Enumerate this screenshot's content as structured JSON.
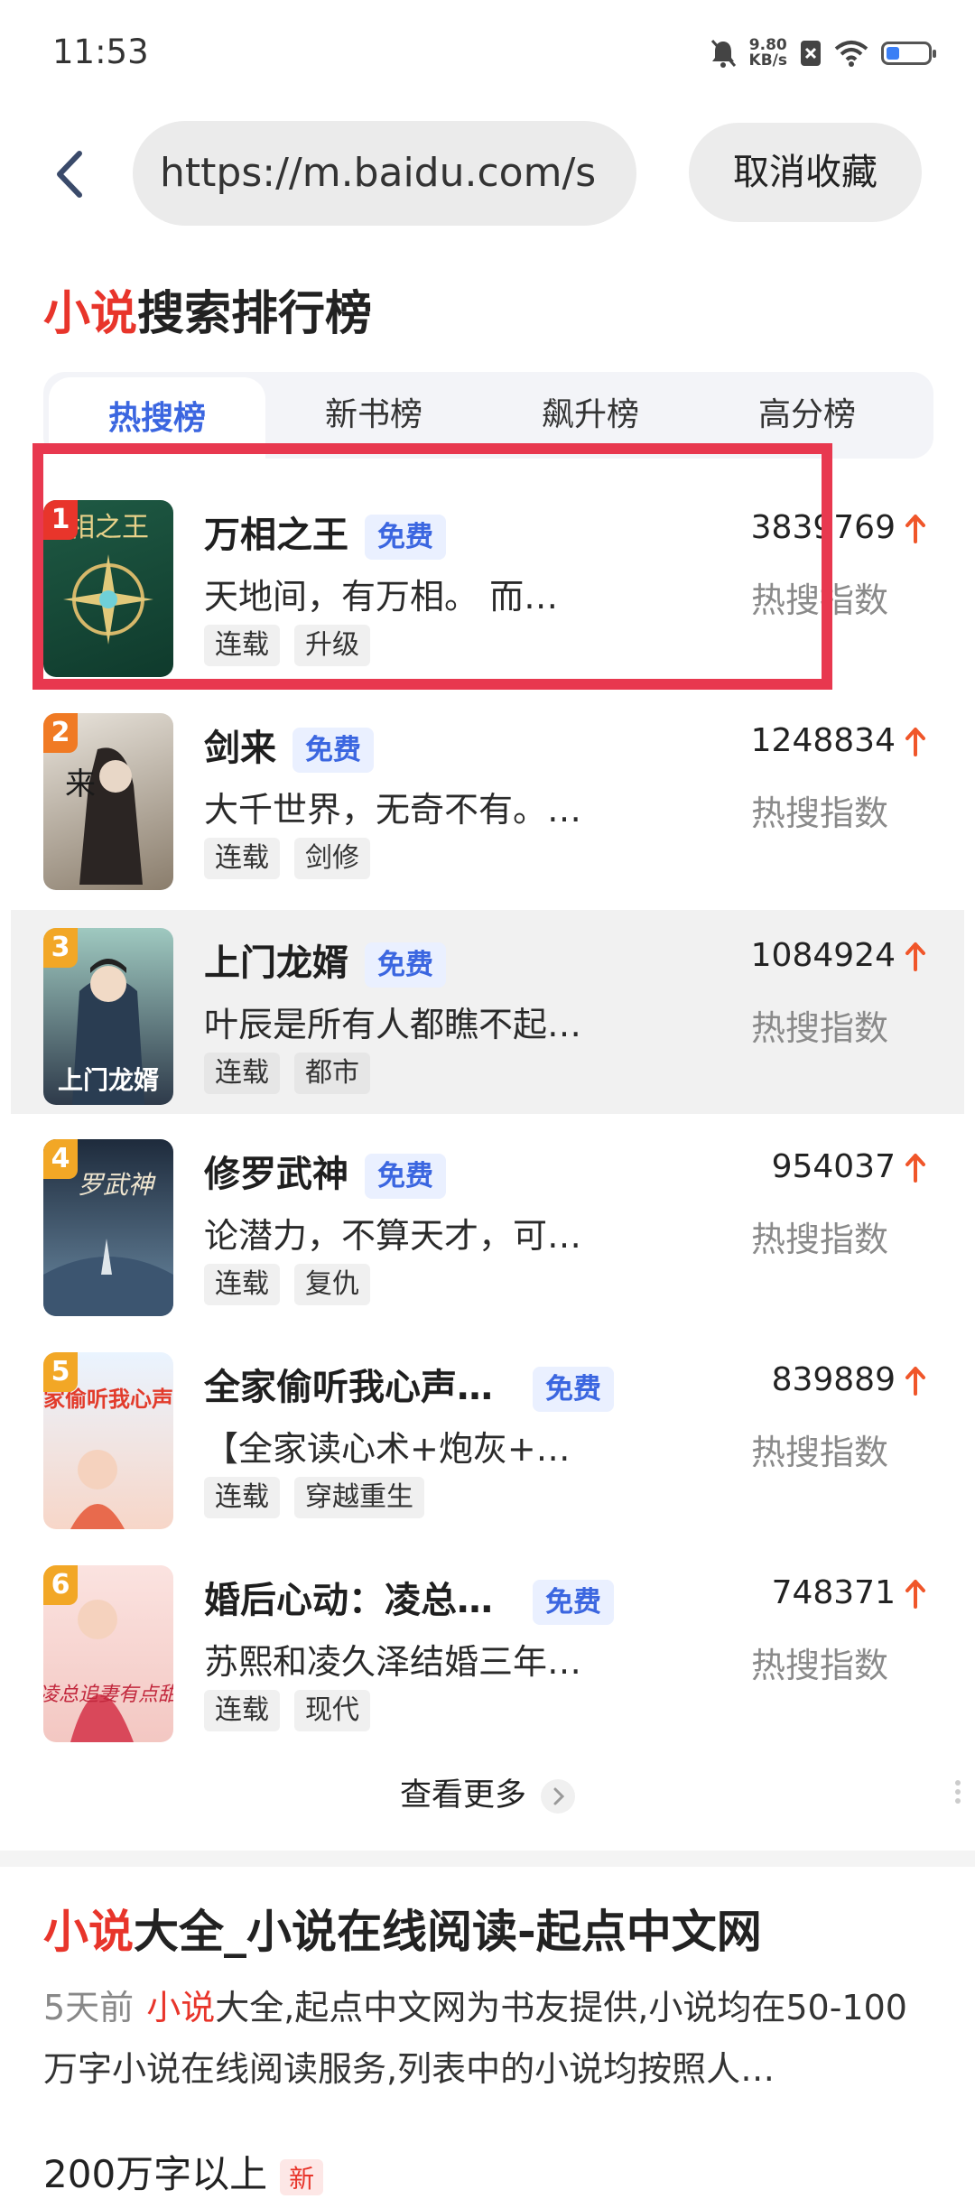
{
  "status_bar": {
    "time": "11:53",
    "net_speed_value": "9.80",
    "net_speed_unit": "KB/s"
  },
  "header": {
    "url": "https://m.baidu.com/s",
    "unfavorite_label": "取消收藏"
  },
  "section": {
    "title_highlight": "小说",
    "title_rest": "搜索排行榜"
  },
  "tabs": [
    {
      "label": "热搜榜",
      "active": true
    },
    {
      "label": "新书榜",
      "active": false
    },
    {
      "label": "飙升榜",
      "active": false
    },
    {
      "label": "高分榜",
      "active": false
    }
  ],
  "items": [
    {
      "rank": "1",
      "name": "万相之王",
      "free": "免费",
      "desc": "天地间，有万相。 而…",
      "tags": [
        "连载",
        "升级"
      ],
      "score": "3839769",
      "score_label": "热搜指数"
    },
    {
      "rank": "2",
      "name": "剑来",
      "free": "免费",
      "desc": "大千世界，无奇不有。…",
      "tags": [
        "连载",
        "剑修"
      ],
      "score": "1248834",
      "score_label": "热搜指数"
    },
    {
      "rank": "3",
      "name": "上门龙婿",
      "free": "免费",
      "desc": "叶辰是所有人都瞧不起…",
      "tags": [
        "连载",
        "都市"
      ],
      "score": "1084924",
      "score_label": "热搜指数"
    },
    {
      "rank": "4",
      "name": "修罗武神",
      "free": "免费",
      "desc": "论潜力，不算天才，可…",
      "tags": [
        "连载",
        "复仇"
      ],
      "score": "954037",
      "score_label": "热搜指数"
    },
    {
      "rank": "5",
      "name": "全家偷听我心声…",
      "free": "免费",
      "desc": "【全家读心术+炮灰+…",
      "tags": [
        "连载",
        "穿越重生"
      ],
      "score": "839889",
      "score_label": "热搜指数"
    },
    {
      "rank": "6",
      "name": "婚后心动：凌总…",
      "free": "免费",
      "desc": "苏熙和凌久泽结婚三年…",
      "tags": [
        "连载",
        "现代"
      ],
      "score": "748371",
      "score_label": "热搜指数"
    }
  ],
  "covers": [
    {
      "text": "相之王"
    },
    {
      "text": "来"
    },
    {
      "text": "上门龙婿"
    },
    {
      "text": "罗武神"
    },
    {
      "text": "家偷听我心声"
    },
    {
      "text": "凌总追妻有点甜"
    }
  ],
  "more": {
    "label": "查看更多"
  },
  "result": {
    "title_highlight": "小说",
    "title_rest": "大全_小说在线阅读-起点中文网",
    "date": "5天前",
    "desc_highlight": "小说",
    "desc_rest": "大全,起点中文网为书友提供,小说均在50-100万字小说在线阅读服务,列表中的小说均按照人…",
    "next_line": "200万字以上",
    "new_badge": "新"
  },
  "colors": {
    "accent_red": "#e8352b",
    "accent_blue": "#3b66e0",
    "arrow": "#f0562a",
    "highlight_box": "#e8384f"
  }
}
